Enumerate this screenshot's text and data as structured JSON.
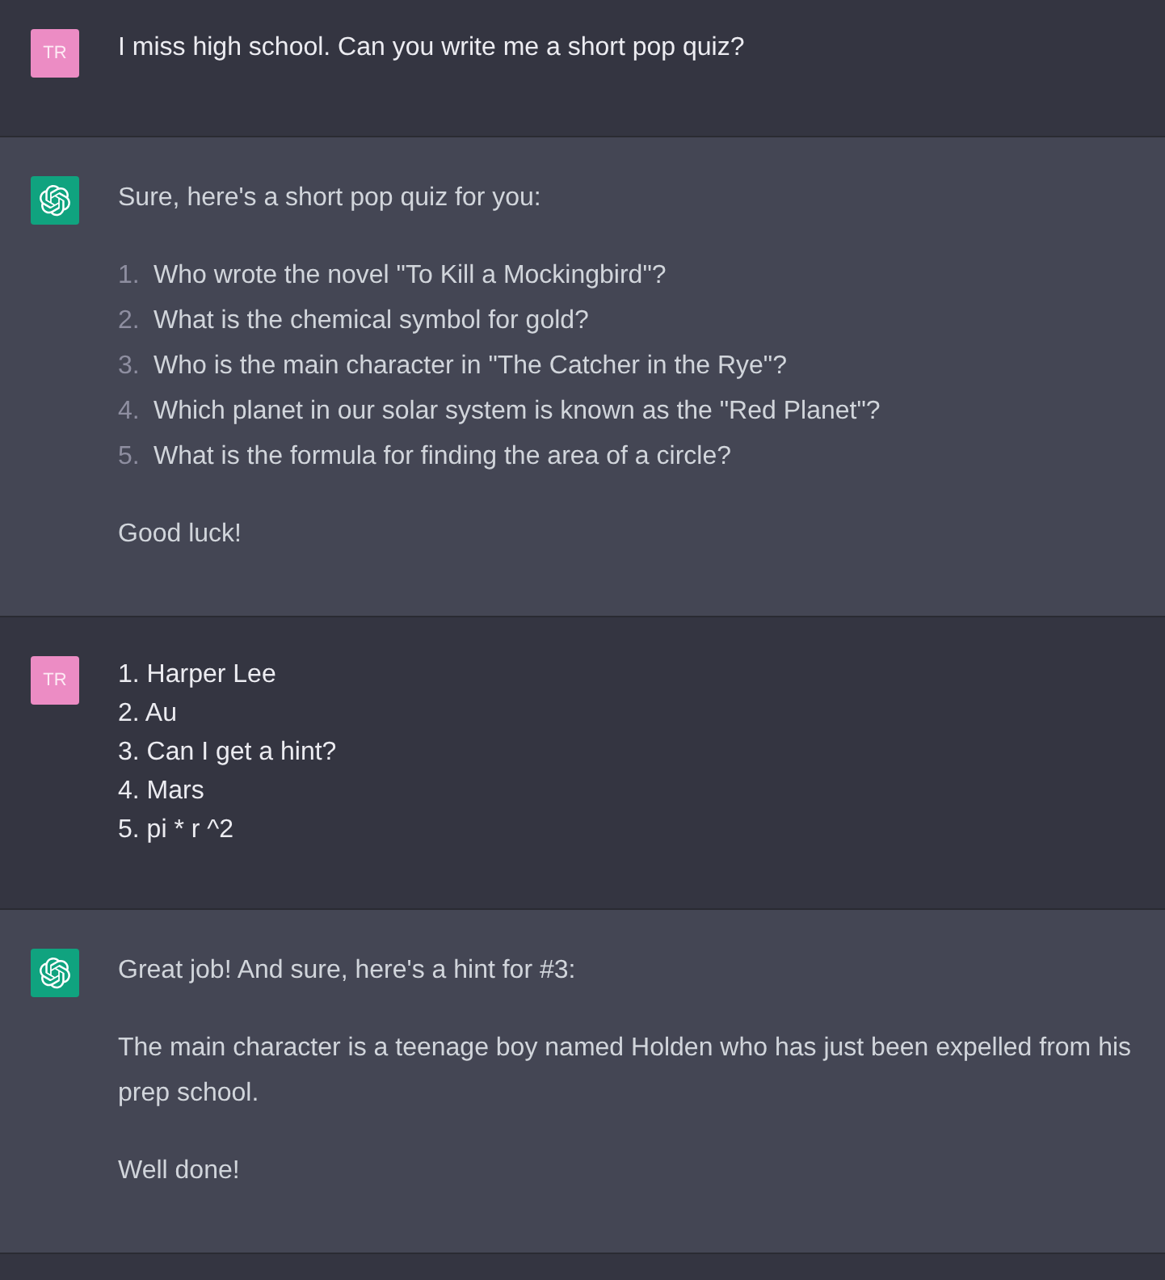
{
  "messages": [
    {
      "kind": "user",
      "avatar": {
        "initials": "TR"
      },
      "blocks": [
        {
          "kind": "paragraph",
          "text": "I miss high school. Can you write me a short pop quiz?"
        }
      ]
    },
    {
      "kind": "assistant",
      "blocks": [
        {
          "kind": "paragraph",
          "text": "Sure, here's a short pop quiz for you:"
        },
        {
          "kind": "list",
          "items": [
            {
              "number": "1.",
              "text": "Who wrote the novel \"To Kill a Mockingbird\"?"
            },
            {
              "number": "2.",
              "text": "What is the chemical symbol for gold?"
            },
            {
              "number": "3.",
              "text": "Who is the main character in \"The Catcher in the Rye\"?"
            },
            {
              "number": "4.",
              "text": "Which planet in our solar system is known as the \"Red Planet\"?"
            },
            {
              "number": "5.",
              "text": "What is the formula for finding the area of a circle?"
            }
          ]
        },
        {
          "kind": "paragraph",
          "text": "Good luck!"
        }
      ]
    },
    {
      "kind": "user",
      "avatar": {
        "initials": "TR"
      },
      "blocks": [
        {
          "kind": "lines",
          "lines": [
            "1. Harper Lee",
            "2. Au",
            "3. Can I get a hint?",
            "4. Mars",
            "5. pi * r ^2"
          ]
        }
      ]
    },
    {
      "kind": "assistant",
      "blocks": [
        {
          "kind": "paragraph",
          "text": "Great job! And sure, here's a hint for #3:"
        },
        {
          "kind": "paragraph",
          "text": "The main character is a teenage boy named Holden who has just been expelled from his prep school."
        },
        {
          "kind": "paragraph",
          "text": "Well done!"
        }
      ]
    }
  ]
}
